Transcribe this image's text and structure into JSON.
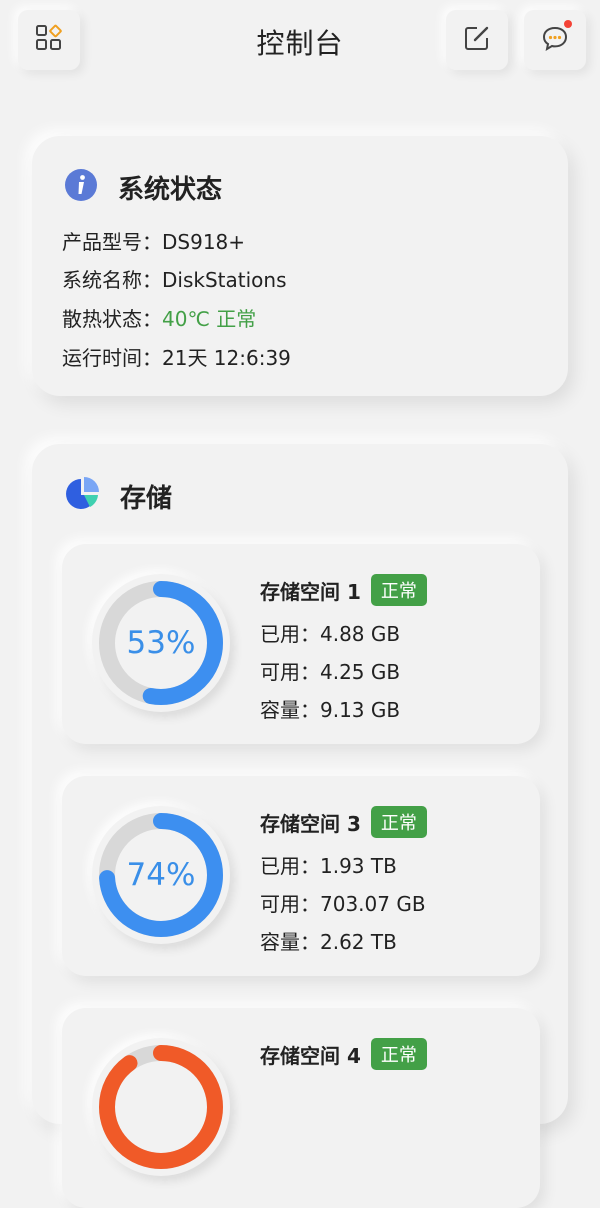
{
  "header": {
    "title": "控制台",
    "left_icon": "apps-grid-icon",
    "edit_icon": "edit-icon",
    "message_icon": "message-icon"
  },
  "system": {
    "title": "系统状态",
    "icon": "info-icon",
    "model_label": "产品型号：",
    "model_value": "DS918+",
    "name_label": "系统名称：",
    "name_value": "DiskStations",
    "thermal_label": "散热状态：",
    "thermal_value": "40℃ 正常",
    "uptime_label": "运行时间：",
    "uptime_value": "21天 12:6:39"
  },
  "storage": {
    "title": "存储",
    "icon": "pie-chart-icon",
    "used_label": "已用：",
    "free_label": "可用：",
    "capacity_label": "容量：",
    "items": [
      {
        "name": "存储空间 1",
        "status": "正常",
        "percent_text": "53%",
        "percent": 53,
        "used": "4.88 GB",
        "free": "4.25 GB",
        "capacity": "9.13 GB",
        "color": "#3d8ff0"
      },
      {
        "name": "存储空间 3",
        "status": "正常",
        "percent_text": "74%",
        "percent": 74,
        "used": "1.93 TB",
        "free": "703.07 GB",
        "capacity": "2.62 TB",
        "color": "#3d8ff0"
      },
      {
        "name": "存储空间 4",
        "status": "正常",
        "percent": 90,
        "color": "#f05a28"
      }
    ]
  },
  "colors": {
    "background": "#f2f2f2",
    "accent_blue": "#3d8ff0",
    "ok_green": "#43a047",
    "warning_orange": "#f05a28",
    "notification_dot": "#f44336"
  }
}
